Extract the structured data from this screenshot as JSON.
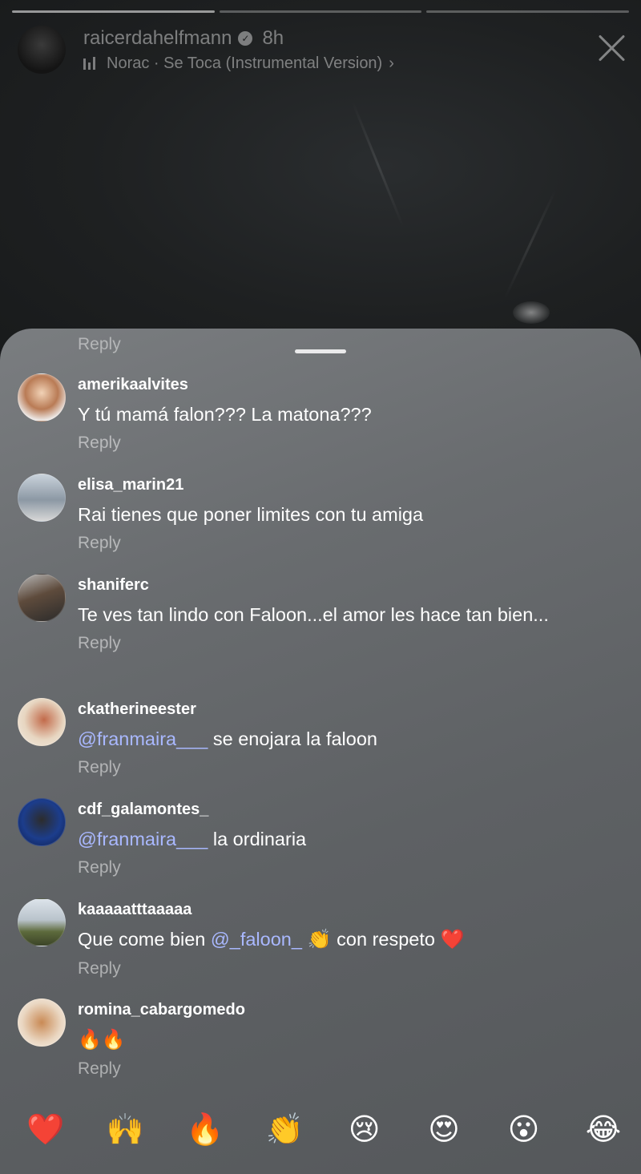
{
  "story": {
    "username": "raicerdahelfmann",
    "time": "8h",
    "music": "Norac · Se Toca (Instrumental Version)",
    "progress_segments": 3,
    "active_segment": 0
  },
  "comments_sheet": {
    "top_reply_label": "Reply",
    "comments": [
      {
        "user": "amerikaalvites",
        "parts": [
          {
            "text": "Y tú mamá falon??? La matona???"
          }
        ],
        "reply": "Reply"
      },
      {
        "user": "elisa_marin21",
        "parts": [
          {
            "text": "Rai tienes que poner limites con tu amiga"
          }
        ],
        "reply": "Reply"
      },
      {
        "user": "shaniferc",
        "parts": [
          {
            "text": "Te ves tan lindo con Faloon...el amor les hace tan bien..."
          }
        ],
        "reply": "Reply"
      },
      {
        "user": "ckatherineester",
        "parts": [
          {
            "text": "@franmaira___",
            "mention": true
          },
          {
            "text": " se enojara la faloon"
          }
        ],
        "reply": "Reply"
      },
      {
        "user": "cdf_galamontes_",
        "parts": [
          {
            "text": "@franmaira___",
            "mention": true
          },
          {
            "text": "  la ordinaria"
          }
        ],
        "reply": "Reply"
      },
      {
        "user": "kaaaaatttaaaaa",
        "parts": [
          {
            "text": "Que come bien "
          },
          {
            "text": "@_faloon_",
            "mention": true
          },
          {
            "text": " 👏 ",
            "emoji": true
          },
          {
            "text": "con respeto "
          },
          {
            "text": "❤️",
            "emoji": true
          }
        ],
        "reply": "Reply"
      },
      {
        "user": "romina_cabargomedo",
        "parts": [
          {
            "text": "🔥🔥",
            "emoji": true
          }
        ],
        "reply": "Reply"
      }
    ]
  },
  "reactions": [
    "❤️",
    "🙌",
    "🔥",
    "👏",
    "😢",
    "😍",
    "😮",
    "😂"
  ],
  "colors": {
    "mention": "#a9b8ff",
    "sheet_top": "#7a7d80",
    "sheet_bottom": "#55585b"
  },
  "icons": {
    "verified": "verified-badge-icon",
    "music": "music-bars-icon",
    "close": "close-icon"
  }
}
